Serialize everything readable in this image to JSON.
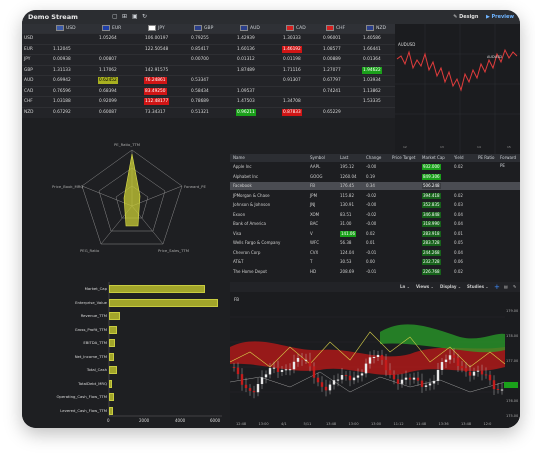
{
  "window": {
    "title": "Demo Stream",
    "design_label": "Design",
    "preview_label": "Preview"
  },
  "colors": {
    "accent": "#3d8cff",
    "up": "#1aa01a",
    "down": "#d01515",
    "highlight": "#a8b020"
  },
  "currency_grid": {
    "columns": [
      "USD",
      "EUR",
      "JPY",
      "GBP",
      "AUD",
      "CAD",
      "CHF",
      "NZD"
    ],
    "rows": [
      {
        "label": "USD",
        "cells": [
          "",
          "1.05264",
          "106.00197",
          "0.79255",
          "1.42939",
          "1.30333",
          "0.96001",
          "1.40586"
        ]
      },
      {
        "label": "EUR",
        "cells": [
          "1.12045",
          "",
          "122.50548",
          "0.85417",
          "1.60136",
          "1.46192",
          "1.08577",
          "1.66441"
        ]
      },
      {
        "label": "JPY",
        "cells": [
          "0.00938",
          "0.00807",
          "",
          "0.00700",
          "0.01312",
          "0.01198",
          "0.00889",
          "0.01364"
        ]
      },
      {
        "label": "GBP",
        "cells": [
          "1.31133",
          "1.17062",
          "142.91575",
          "",
          "1.87489",
          "1.71116",
          "1.27077",
          "1.94622"
        ]
      },
      {
        "label": "AUD",
        "cells": [
          "0.69942",
          "0.62452",
          "76.24861",
          "0.53347",
          "",
          "0.91307",
          "0.67797",
          "1.03934"
        ]
      },
      {
        "label": "CAD",
        "cells": [
          "0.76596",
          "0.68394",
          "83.49250",
          "0.58434",
          "1.09537",
          "",
          "0.74241",
          "1.13862"
        ]
      },
      {
        "label": "CHF",
        "cells": [
          "1.03188",
          "0.92099",
          "112.48177",
          "0.78689",
          "1.47503",
          "1.34708",
          "",
          "1.53335"
        ]
      },
      {
        "label": "NZD",
        "cells": [
          "0.67292",
          "0.60087",
          "73.34317",
          "0.51321",
          "0.96211",
          "0.87833",
          "0.65229",
          ""
        ]
      }
    ]
  },
  "top_chart": {
    "ticker": "AUDUSD",
    "right_label": "AUDUSD"
  },
  "radar": {
    "labels": [
      "PE_Ratio_TTM",
      "Forward_PE",
      "Price_Sales_TTM",
      "PEG_Ratio",
      "Price_Book_MRQ"
    ]
  },
  "stock_table": {
    "headers": [
      "Name",
      "Symbol",
      "Last",
      "Change",
      "Price Target",
      "Market Cap",
      "Yield",
      "PE Ratio",
      "Forward PE"
    ],
    "rows": [
      {
        "name": "Apple Inc",
        "symbol": "AAPL",
        "last": "195.12",
        "change": "-0.00",
        "target": "",
        "cap": "932.000",
        "yield": "0.02"
      },
      {
        "name": "Alphabet Inc",
        "symbol": "GOOG",
        "last": "1260.04",
        "change": "0.19",
        "target": "",
        "cap": "849.306",
        "yield": ""
      },
      {
        "name": "Facebook",
        "symbol": "FB",
        "last": "176.45",
        "change": "0.34",
        "target": "",
        "cap": "506.248",
        "yield": ""
      },
      {
        "name": "JPMorgan & Chase",
        "symbol": "JPM",
        "last": "115.82",
        "change": "-0.02",
        "target": "",
        "cap": "394.418",
        "yield": "0.02"
      },
      {
        "name": "Johnson & Johnson",
        "symbol": "JNJ",
        "last": "130.91",
        "change": "-0.00",
        "target": "",
        "cap": "352.835",
        "yield": "0.03"
      },
      {
        "name": "Exxon",
        "symbol": "XOM",
        "last": "83.51",
        "change": "-0.02",
        "target": "",
        "cap": "346.848",
        "yield": "0.04"
      },
      {
        "name": "Bank of America",
        "symbol": "BAC",
        "last": "31.00",
        "change": "-0.00",
        "target": "",
        "cap": "318.990",
        "yield": "0.04"
      },
      {
        "name": "Visa",
        "symbol": "V",
        "last": "141.06",
        "change": "0.02",
        "target": "",
        "cap": "283.918",
        "yield": "0.01"
      },
      {
        "name": "Wells Fargo & Company",
        "symbol": "WFC",
        "last": "56.38",
        "change": "0.01",
        "target": "",
        "cap": "283.728",
        "yield": "0.05"
      },
      {
        "name": "Chevron Corp",
        "symbol": "CVX",
        "last": "124.04",
        "change": "-0.01",
        "target": "",
        "cap": "244.268",
        "yield": "0.04"
      },
      {
        "name": "AT&T",
        "symbol": "T",
        "last": "30.53",
        "change": "0.00",
        "target": "",
        "cap": "232.728",
        "yield": "0.06"
      },
      {
        "name": "The Home Depot",
        "symbol": "HD",
        "last": "208.69",
        "change": "-0.01",
        "target": "",
        "cap": "226.768",
        "yield": "0.02"
      }
    ]
  },
  "bar_chart": {
    "labels": [
      "Market_Cap",
      "Enterprise_Value",
      "Revenue_TTM",
      "Gross_Profit_TTM",
      "EBITDA_TTM",
      "Net_Income_TTM",
      "Total_Cash",
      "TotalDebt_MRQ",
      "Operating_Cash_Flow_TTM",
      "Levered_Cash_Flow_TTM"
    ],
    "ticks": [
      "0",
      "2000",
      "4000",
      "6000"
    ]
  },
  "chart_data": {
    "type": "bar",
    "categories": [
      "Market_Cap",
      "Enterprise_Value",
      "Revenue_TTM",
      "Gross_Profit_TTM",
      "EBITDA_TTM",
      "Net_Income_TTM",
      "Total_Cash",
      "TotalDebt_MRQ",
      "Operating_Cash_Flow_TTM",
      "Levered_Cash_Flow_TTM"
    ],
    "values": [
      5000,
      5700,
      500,
      300,
      200,
      150,
      300,
      50,
      150,
      100
    ],
    "xlim": [
      0,
      6000
    ]
  },
  "candle_chart": {
    "ticker": "FB",
    "toolbar": {
      "line": "Ln",
      "views": "Views",
      "display": "Display",
      "studies": "Studies"
    },
    "x_ticks": [
      "12:48",
      "13:00",
      "4/1",
      "5/11",
      "13:48",
      "13:00",
      "13:00",
      "11:12",
      "11:48",
      "13:36",
      "13:48",
      "12:0"
    ],
    "y_ticks": [
      "179.00",
      "178.00",
      "177.00",
      "176.00",
      "175.00"
    ]
  }
}
